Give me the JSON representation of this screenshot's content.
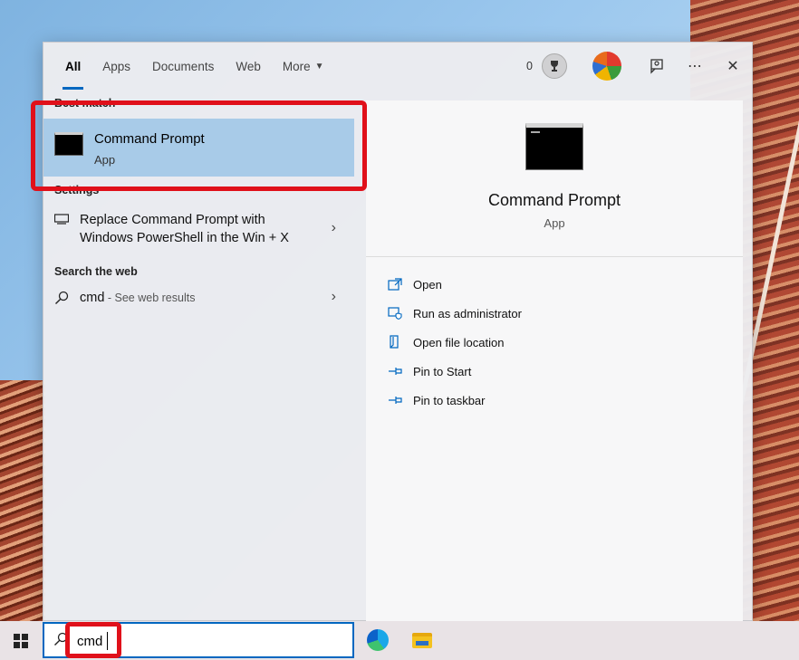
{
  "tabs": [
    {
      "label": "All",
      "active": true
    },
    {
      "label": "Apps"
    },
    {
      "label": "Documents"
    },
    {
      "label": "Web"
    },
    {
      "label": "More"
    }
  ],
  "header": {
    "points": "0",
    "icons": [
      "trophy-icon",
      "avatar",
      "feedback-icon",
      "more-options-icon",
      "close-icon"
    ],
    "more_glyph": "⋯",
    "close_glyph": "✕"
  },
  "left": {
    "best_match_title": "Best match",
    "best_match": {
      "title": "Command Prompt",
      "subtitle": "App"
    },
    "settings_title": "Settings",
    "settings_item": {
      "line1": "Replace Command Prompt with",
      "line2": "Windows PowerShell in the Win + X"
    },
    "web_title": "Search the web",
    "web_item": {
      "query": "cmd",
      "suffix": " - See web results"
    }
  },
  "detail": {
    "title": "Command Prompt",
    "subtitle": "App",
    "actions": [
      {
        "label": "Open",
        "icon": "open-icon"
      },
      {
        "label": "Run as administrator",
        "icon": "shield-icon"
      },
      {
        "label": "Open file location",
        "icon": "file-location-icon"
      },
      {
        "label": "Pin to Start",
        "icon": "pin-icon"
      },
      {
        "label": "Pin to taskbar",
        "icon": "pin-icon"
      }
    ]
  },
  "taskbar": {
    "search_value": "cmd",
    "apps": [
      "edge-icon",
      "file-explorer-icon"
    ]
  },
  "colors": {
    "accent": "#0067c0",
    "highlight_box": "#e0101a",
    "selected_row": "#a8cbe8"
  }
}
